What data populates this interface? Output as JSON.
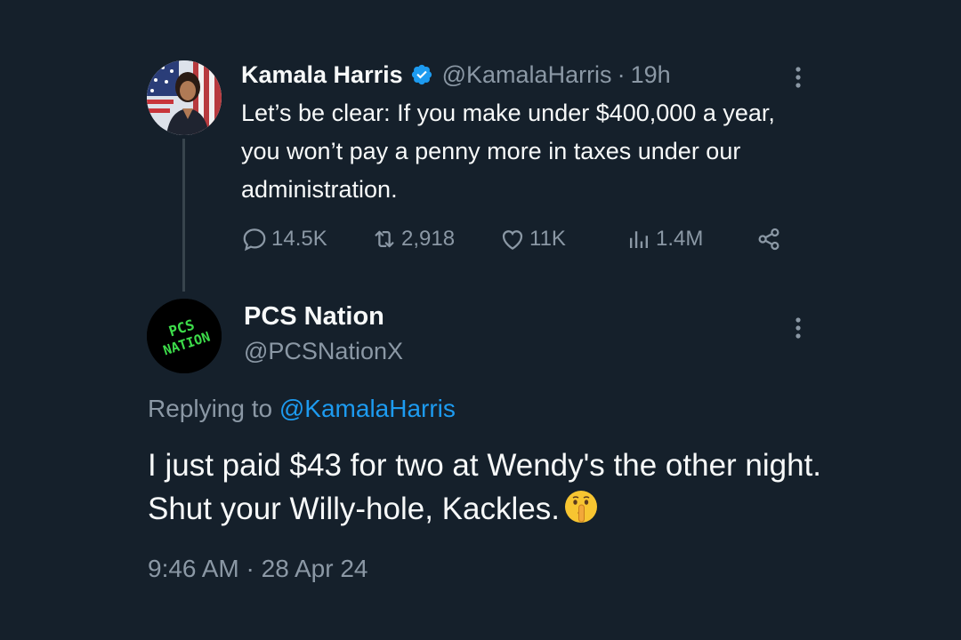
{
  "parent_tweet": {
    "author_name": "Kamala Harris",
    "handle": "@KamalaHarris",
    "separator": "·",
    "time_ago": "19h",
    "text": "Let’s be clear: If you make under $400,000 a year, you won’t pay a penny more in taxes under our administration.",
    "stats": {
      "replies": "14.5K",
      "reposts": "2,918",
      "likes": "11K",
      "views": "1.4M"
    },
    "icons": {
      "verified": "verified-badge-icon",
      "more": "more-options-icon",
      "reply": "reply-icon",
      "repost": "repost-icon",
      "like": "like-icon",
      "views": "views-icon",
      "share": "share-icon"
    }
  },
  "reply_tweet": {
    "author_name": "PCS Nation",
    "handle": "@PCSNationX",
    "avatar_text": "PCS NATION",
    "replying_prefix": "Replying to",
    "replying_mention": "@KamalaHarris",
    "text": "I just paid $43 for two at Wendy's the other night. Shut your Willy-hole, Kackles.",
    "emoji": "shushing-face-emoji",
    "timestamp_time": "9:46 AM",
    "separator": "·",
    "timestamp_date": "28 Apr 24"
  },
  "colors": {
    "background": "#15202b",
    "primary_text": "#f7f9f9",
    "secondary_text": "#8b98a5",
    "link": "#1d9bf0",
    "verified": "#1d9bf0",
    "pcs_avatar_text": "#3ddc4a"
  }
}
